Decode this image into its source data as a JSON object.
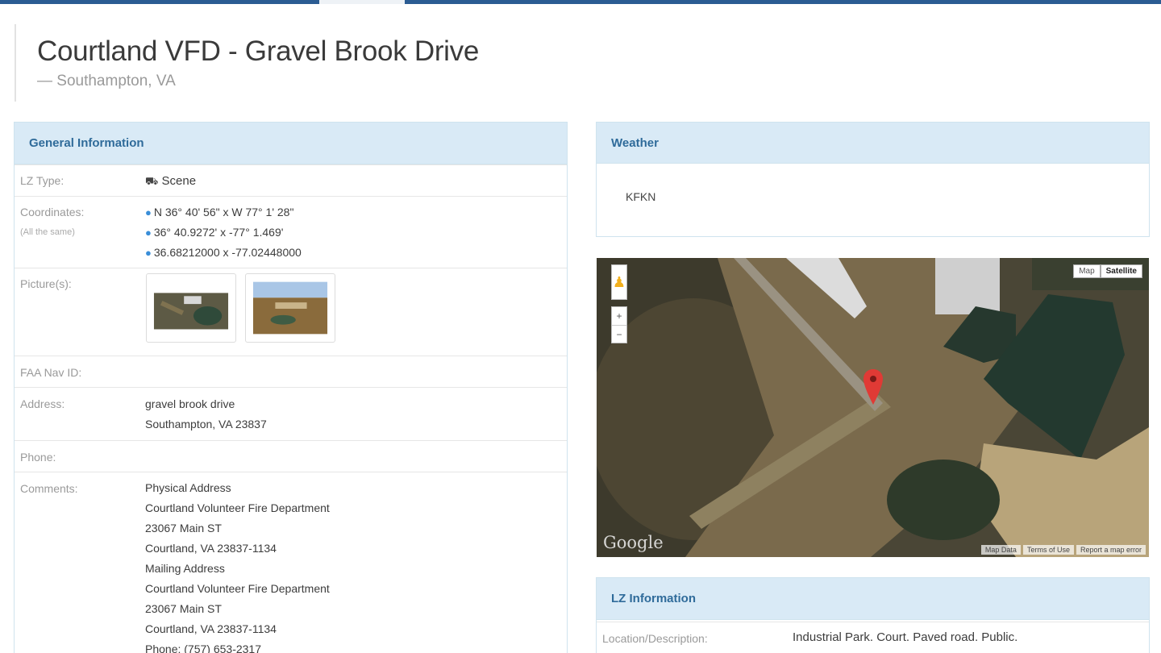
{
  "header": {
    "title": "Courtland VFD - Gravel Brook Drive",
    "subtitle": "— Southampton, VA"
  },
  "general": {
    "heading": "General Information",
    "lz_type_label": "LZ Type:",
    "lz_type_icon": "truck-icon",
    "lz_type_value": "Scene",
    "coordinates_label": "Coordinates:",
    "coordinates_note": "(All the same)",
    "coordinates": [
      "N 36° 40' 56\" x W 77° 1' 28\"",
      "36° 40.9272' x -77° 1.469'",
      "36.68212000 x -77.02448000"
    ],
    "pictures_label": "Picture(s):",
    "faa_label": "FAA Nav ID:",
    "address_label": "Address:",
    "address_lines": [
      "gravel brook drive",
      "Southampton, VA 23837"
    ],
    "phone_label": "Phone:",
    "comments_label": "Comments:",
    "comments_lines": [
      "Physical Address",
      "Courtland Volunteer Fire Department",
      "23067 Main ST",
      "Courtland, VA 23837-1134",
      "Mailing Address",
      "Courtland Volunteer Fire Department",
      "23067 Main ST",
      "Courtland, VA 23837-1134",
      "Phone: (757) 653-2317"
    ]
  },
  "weather": {
    "heading": "Weather",
    "station": "KFKN"
  },
  "map": {
    "type_map": "Map",
    "type_satellite": "Satellite",
    "zoom_in": "+",
    "zoom_out": "−",
    "logo": "Google",
    "footer": [
      "Map Data",
      "Terms of Use",
      "Report a map error"
    ],
    "marker_color": "#e03a35"
  },
  "lz_info": {
    "heading": "LZ Information",
    "location_label": "Location/Description:",
    "location_value": "Industrial Park. Court. Paved road. Public."
  }
}
